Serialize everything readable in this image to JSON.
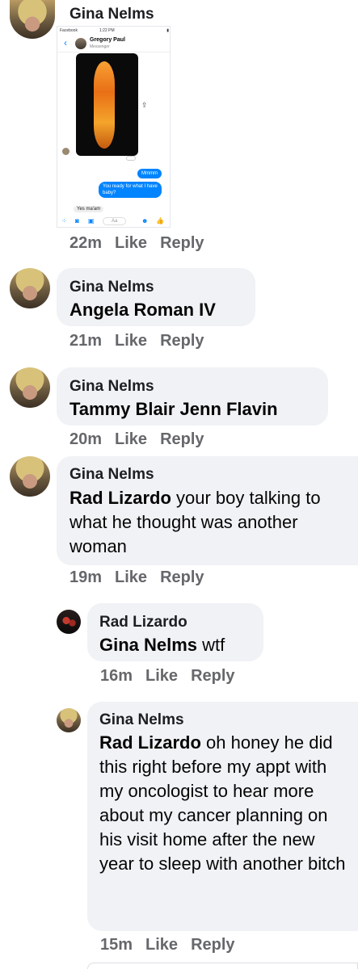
{
  "comments": [
    {
      "author": "Gina Nelms",
      "time": "22m",
      "like": "Like",
      "reply": "Reply",
      "screenshot": {
        "status_left": "Facebook",
        "status_time": "1:22 PM",
        "contact_name": "Gregory Paul",
        "contact_sub": "Messenger",
        "messages": [
          "Mmmm",
          "You ready for what I have baby?",
          "Yes ma'am"
        ],
        "input_placeholder": "Aa"
      }
    },
    {
      "author": "Gina Nelms",
      "mention": "Angela Roman IV",
      "text": "",
      "time": "21m",
      "like": "Like",
      "reply": "Reply"
    },
    {
      "author": "Gina Nelms",
      "mention": "Tammy Blair Jenn Flavin",
      "text": "",
      "time": "20m",
      "like": "Like",
      "reply": "Reply"
    },
    {
      "author": "Gina Nelms",
      "mention": "Rad Lizardo",
      "text": " your boy talking to what he thought was another woman",
      "time": "19m",
      "like": "Like",
      "reply": "Reply"
    },
    {
      "author": "Rad Lizardo",
      "mention": "Gina Nelms",
      "text": " wtf",
      "time": "16m",
      "like": "Like",
      "reply": "Reply"
    },
    {
      "author": "Gina Nelms",
      "mention": "Rad Lizardo",
      "text": " oh honey he did this right before my appt with my oncologist to hear more about my cancer planning on his visit home after the new year to sleep with another bitch",
      "time": "15m",
      "like": "Like",
      "reply": "Reply"
    }
  ]
}
